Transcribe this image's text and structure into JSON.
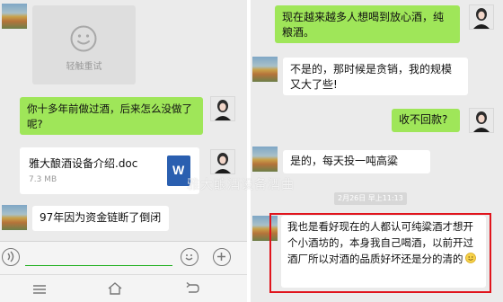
{
  "left_chat": {
    "image_placeholder": {
      "label": "轻触重试"
    },
    "messages": [
      {
        "side": "right",
        "type": "text",
        "text": "你十多年前做过酒，后来怎么没做了呢?"
      },
      {
        "side": "right",
        "type": "file",
        "file_name": "雅大酿酒设备介绍.doc",
        "file_size": "7.3 MB",
        "file_icon": "W"
      },
      {
        "side": "left",
        "type": "text",
        "text": "97年因为资金链断了倒闭"
      }
    ],
    "input_bar": {
      "voice_icon": "voice-icon",
      "emoji_icon": "emoji-icon",
      "plus_icon": "plus-icon"
    },
    "nav_bar": {
      "menu_icon": "menu-icon",
      "home_icon": "home-icon",
      "back_icon": "back-icon"
    }
  },
  "right_chat": {
    "messages": [
      {
        "side": "left",
        "type": "text",
        "text": "现在越来越多人想喝到放心酒，纯粮酒。"
      },
      {
        "side": "left",
        "type": "text",
        "text": "不是的，那时候是贪销，我的规模又大了些!"
      },
      {
        "side": "right",
        "type": "text",
        "text": "收不回款?"
      },
      {
        "side": "left",
        "type": "text",
        "text": "是的，每天投一吨高粱"
      },
      {
        "side": "left",
        "type": "text",
        "text": "我也是看好现在的人都认可纯粱酒才想开个小酒坊的，本身我自己喝酒，以前开过酒厂所以对酒的品质好坏还是分的清的"
      }
    ],
    "timestamp": "2月26日 早上11:13"
  },
  "watermark": "雅大酿酒设备酒曲",
  "colors": {
    "bubble_green": "#9fe659",
    "bubble_white": "#ffffff",
    "chat_bg": "#ebebeb",
    "highlight_box": "#e0141c"
  }
}
